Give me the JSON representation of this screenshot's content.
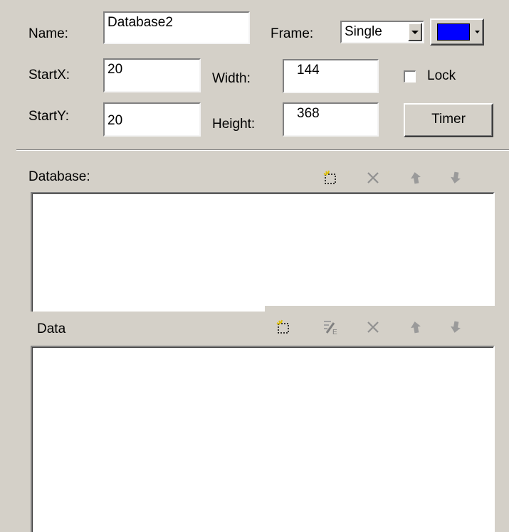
{
  "props": {
    "name_label": "Name:",
    "name_value": "Database2",
    "frame_label": "Frame:",
    "frame_value": "Single",
    "frame_color": "#0000ff",
    "startx_label": "StartX:",
    "startx_value": "20",
    "width_label": "Width:",
    "width_value": "144",
    "lock_label": "Lock",
    "lock_checked": false,
    "starty_label": "StartY:",
    "starty_value": "20",
    "height_label": "Height:",
    "height_value": "368",
    "timer_label": "Timer"
  },
  "database": {
    "label": "Database:",
    "tools": [
      "new-icon",
      "delete-icon",
      "move-up-icon",
      "move-down-icon"
    ],
    "items": []
  },
  "data_section": {
    "label": "Data",
    "tools": [
      "new-icon",
      "edit-icon",
      "delete-icon",
      "move-up-icon",
      "move-down-icon"
    ],
    "items": []
  }
}
